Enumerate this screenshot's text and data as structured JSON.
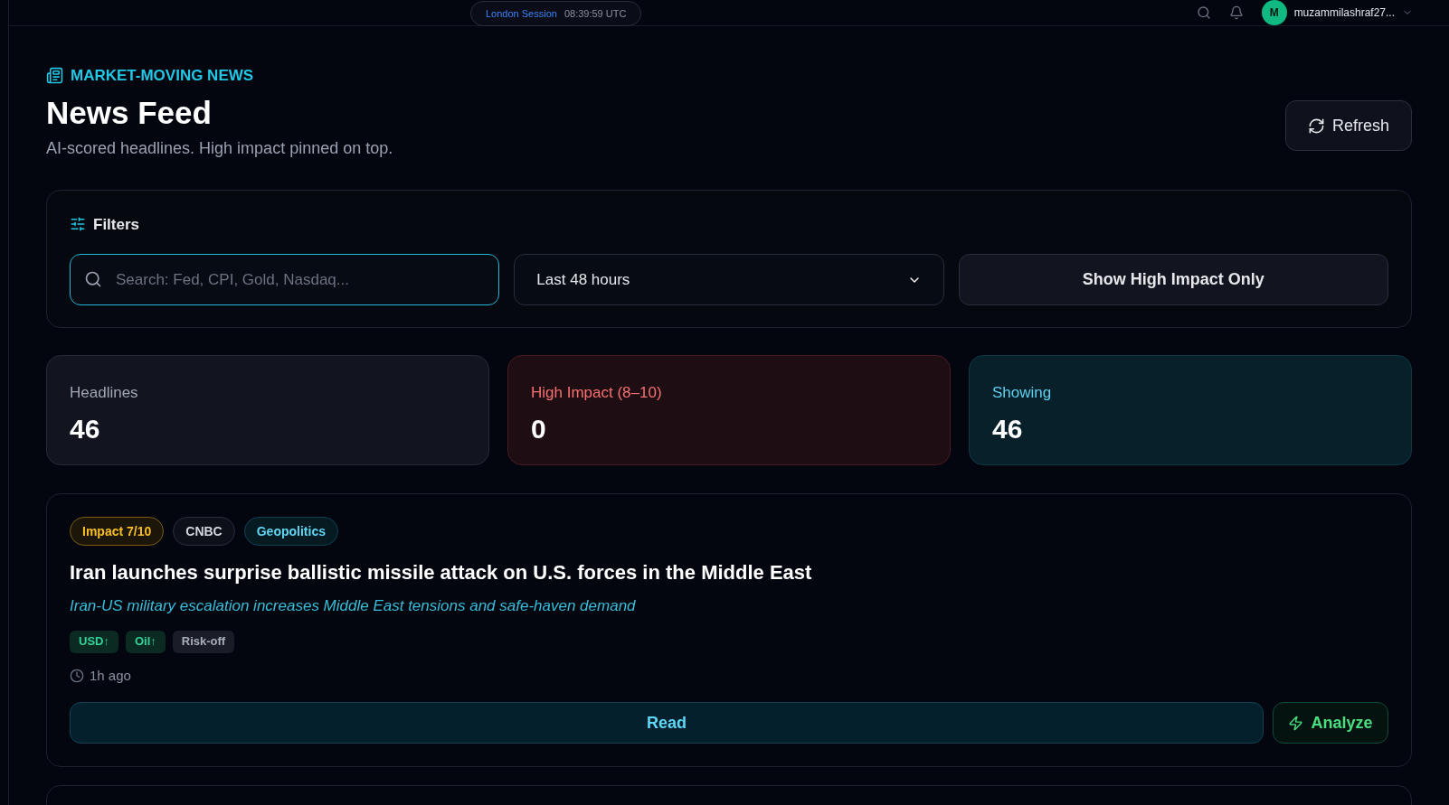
{
  "top_bar": {
    "session": "London Session",
    "clock": "08:39:59 UTC",
    "avatar_initial": "M",
    "username": "muzammilashraf27..."
  },
  "header": {
    "eyebrow": "MARKET-MOVING NEWS",
    "title": "News Feed",
    "subtitle": "AI-scored headlines. High impact pinned on top.",
    "refresh_button": "Refresh"
  },
  "filters": {
    "title": "Filters",
    "search": {
      "placeholder": "Search: Fed, CPI, Gold, Nasdaq..."
    },
    "range": "Last 48 hours",
    "high_impact_toggle": {
      "label": "Show High Impact Only",
      "on": false
    }
  },
  "stats": [
    {
      "label": "Headlines",
      "value": "46",
      "kind": "neutral"
    },
    {
      "label": "High Impact (8–10)",
      "value": "0",
      "kind": "danger"
    },
    {
      "label": "Showing",
      "value": "46",
      "kind": "info"
    }
  ],
  "news": [
    {
      "tags": [
        {
          "label": "Impact 7/10",
          "kind": "impact"
        },
        {
          "label": "CNBC",
          "kind": "source"
        },
        {
          "label": "Geopolitics",
          "kind": "category"
        }
      ],
      "headline": "Iran launches surprise ballistic missile attack on U.S. forces in the Middle East",
      "summary": "Iran-US military escalation increases Middle East tensions and safe-haven demand",
      "assets": [
        {
          "label": "USD↑",
          "kind": "up"
        },
        {
          "label": "Oil↑",
          "kind": "up"
        },
        {
          "label": "Risk-off",
          "kind": "neutral"
        }
      ],
      "time": "1h ago",
      "read_button": "Read",
      "analyze_button": "Analyze"
    }
  ]
}
